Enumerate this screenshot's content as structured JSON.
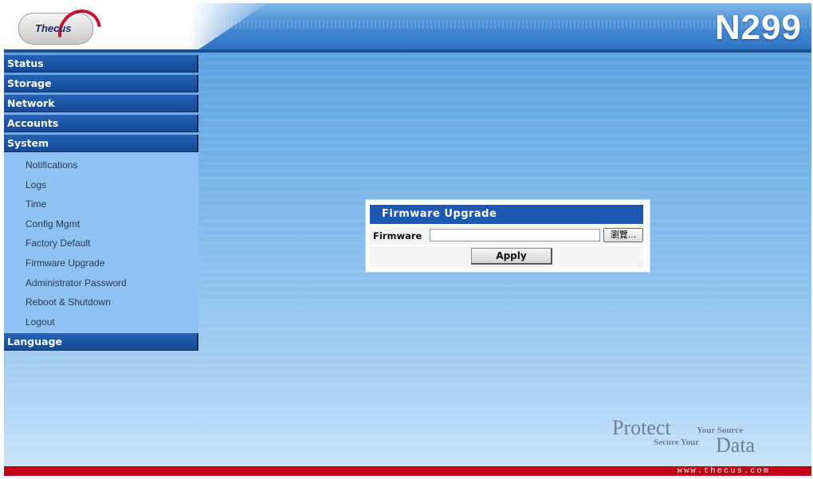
{
  "header": {
    "logo_text": "Thecus",
    "model": "N299"
  },
  "sidebar": {
    "menus": [
      {
        "label": "Status"
      },
      {
        "label": "Storage"
      },
      {
        "label": "Network"
      },
      {
        "label": "Accounts"
      },
      {
        "label": "System"
      }
    ],
    "system_items": [
      {
        "label": "Notifications"
      },
      {
        "label": "Logs"
      },
      {
        "label": "Time"
      },
      {
        "label": "Config Mgmt"
      },
      {
        "label": "Factory Default"
      },
      {
        "label": "Firmware Upgrade"
      },
      {
        "label": "Administrator Password"
      },
      {
        "label": "Reboot & Shutdown"
      },
      {
        "label": "Logout"
      }
    ],
    "language": {
      "label": "Language"
    }
  },
  "dialog": {
    "title": "Firmware Upgrade",
    "field_label": "Firmware",
    "file_value": "",
    "browse_label": "瀏覽...",
    "apply_label": "Apply"
  },
  "footer": {
    "tagline_protect": "Protect",
    "tagline_your_source": "Your Source",
    "tagline_secure_your": "Secure Your",
    "tagline_data": "Data",
    "url": "www.thecus.com"
  },
  "colors": {
    "menu_blue": "#1d58b0",
    "submenu_bg": "#8ec2f3",
    "footer_red": "#c00016"
  }
}
